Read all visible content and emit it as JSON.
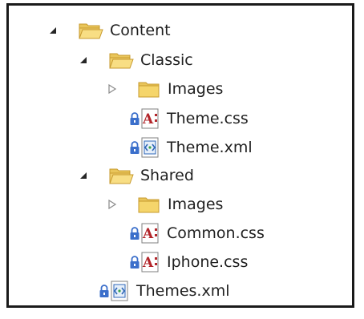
{
  "tree": {
    "nodes": [
      {
        "label": "Content",
        "icon": "folder-open-icon",
        "expander": "expanded",
        "locked": false
      },
      {
        "label": "Classic",
        "icon": "folder-open-icon",
        "expander": "expanded",
        "locked": false
      },
      {
        "label": "Images",
        "icon": "folder-closed-icon",
        "expander": "collapsed",
        "locked": false
      },
      {
        "label": "Theme.css",
        "icon": "css-file-icon",
        "expander": "none",
        "locked": true
      },
      {
        "label": "Theme.xml",
        "icon": "xml-file-icon",
        "expander": "none",
        "locked": true
      },
      {
        "label": "Shared",
        "icon": "folder-open-icon",
        "expander": "expanded",
        "locked": false
      },
      {
        "label": "Images",
        "icon": "folder-closed-icon",
        "expander": "collapsed",
        "locked": false
      },
      {
        "label": "Common.css",
        "icon": "css-file-icon",
        "expander": "none",
        "locked": true
      },
      {
        "label": "Iphone.css",
        "icon": "css-file-icon",
        "expander": "none",
        "locked": true
      },
      {
        "label": "Themes.xml",
        "icon": "xml-file-icon",
        "expander": "none",
        "locked": true
      }
    ]
  },
  "colors": {
    "folder_fill": "#f5d56b",
    "folder_edge": "#c79a2e",
    "lock_blue": "#3b6fcb",
    "css_red": "#b3262b",
    "xml_blue": "#2f67b8"
  }
}
